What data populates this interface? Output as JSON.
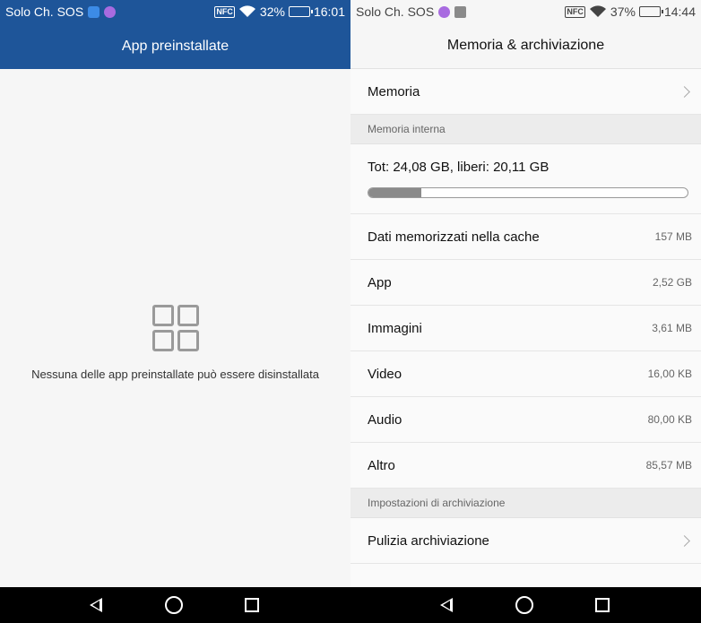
{
  "left": {
    "status": {
      "carrier": "Solo Ch. SOS",
      "nfc": "NFC",
      "battery": "32%",
      "battery_level": 0.32,
      "time": "16:01"
    },
    "header": {
      "title": "App preinstallate"
    },
    "empty": {
      "icon": "grid-apps-icon",
      "message": "Nessuna delle app preinstallate può essere disinstallata"
    }
  },
  "right": {
    "status": {
      "carrier": "Solo Ch. SOS",
      "nfc": "NFC",
      "battery": "37%",
      "battery_level": 0.37,
      "time": "14:44"
    },
    "header": {
      "title": "Memoria & archiviazione"
    },
    "memoria": {
      "label": "Memoria"
    },
    "internal_section": {
      "label": "Memoria interna"
    },
    "storage": {
      "summary": "Tot: 24,08 GB, liberi: 20,11 GB",
      "used_fraction": 0.165
    },
    "items": [
      {
        "label": "Dati memorizzati nella cache",
        "value": "157 MB"
      },
      {
        "label": "App",
        "value": "2,52 GB"
      },
      {
        "label": "Immagini",
        "value": "3,61 MB"
      },
      {
        "label": "Video",
        "value": "16,00 KB"
      },
      {
        "label": "Audio",
        "value": "80,00 KB"
      },
      {
        "label": "Altro",
        "value": "85,57 MB"
      }
    ],
    "settings_section": {
      "label": "Impostazioni di archiviazione"
    },
    "cleanup": {
      "label": "Pulizia archiviazione"
    }
  },
  "colors": {
    "header_blue": "#1e5599",
    "section_gray": "#ececec",
    "bar_fill": "#8a8a8a"
  },
  "navbar": {
    "icons": [
      "back-icon",
      "home-icon",
      "recent-apps-icon"
    ]
  }
}
